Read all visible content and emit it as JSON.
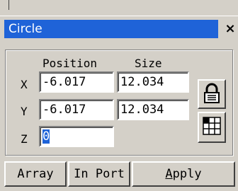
{
  "panel": {
    "title": "Circle",
    "close_glyph": "×",
    "col_position": "Position",
    "col_size": "Size"
  },
  "rows": {
    "x": {
      "label": "X",
      "position": "-6.017",
      "size": "12.034"
    },
    "y": {
      "label": "Y",
      "position": "-6.017",
      "size": "12.034"
    },
    "z": {
      "label": "Z",
      "position": "0"
    }
  },
  "icons": {
    "lock": "lock-icon",
    "grid": "grid-icon"
  },
  "buttons": {
    "array": "Array",
    "in_port": "In Port",
    "apply_first": "A",
    "apply_rest": "pply"
  },
  "colors": {
    "titlebar": "#1f63d8",
    "face": "#d4d0c8"
  }
}
